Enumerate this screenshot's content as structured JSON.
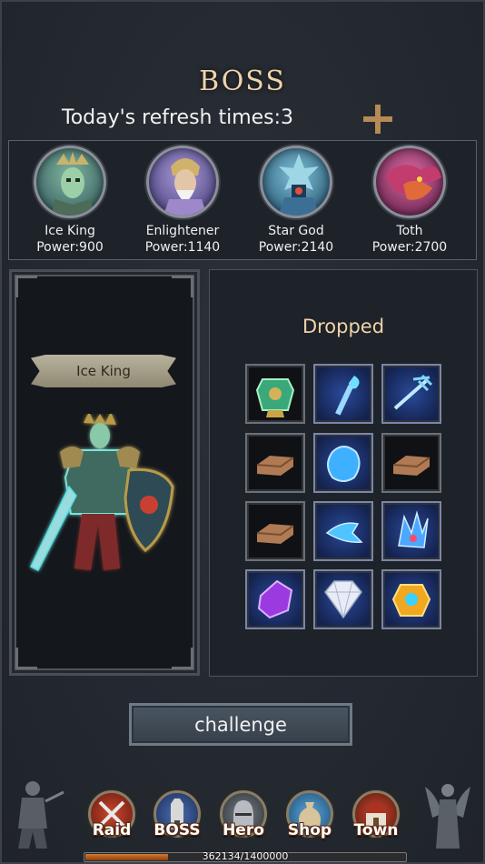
{
  "header": {
    "title": "BOSS",
    "refresh_label": "Today's  refresh times:3",
    "add_icon": "plus-icon",
    "accent_color": "#b58b55"
  },
  "bosses": [
    {
      "name": "Ice King",
      "power": "Power:900",
      "color": "#4f8a74"
    },
    {
      "name": "Enlightener",
      "power": "Power:1140",
      "color": "#7e6fb5"
    },
    {
      "name": "Star God",
      "power": "Power:2140",
      "color": "#3a7fa8"
    },
    {
      "name": "Toth",
      "power": "Power:2700",
      "color": "#b03a78"
    }
  ],
  "selected_boss": {
    "name": "Ice King"
  },
  "drops": {
    "title": "Dropped",
    "items": [
      {
        "icon": "jade-armor-icon",
        "style": "dark"
      },
      {
        "icon": "blue-staff-icon",
        "style": "blue"
      },
      {
        "icon": "blue-trident-icon",
        "style": "blue"
      },
      {
        "icon": "wood-plank-icon",
        "style": "dark"
      },
      {
        "icon": "blue-crystal-icon",
        "style": "blue"
      },
      {
        "icon": "wood-plank-icon",
        "style": "dark"
      },
      {
        "icon": "wood-plank-icon",
        "style": "dark"
      },
      {
        "icon": "blue-axe-icon",
        "style": "blue"
      },
      {
        "icon": "blue-claw-icon",
        "style": "blue"
      },
      {
        "icon": "purple-gem-icon",
        "style": "blue"
      },
      {
        "icon": "diamond-icon",
        "style": "blue"
      },
      {
        "icon": "gold-amulet-icon",
        "style": "blue"
      }
    ]
  },
  "challenge": {
    "label": "challenge"
  },
  "nav": [
    {
      "label": "Raid",
      "icon": "crossed-swords-icon",
      "color": "#a8321e"
    },
    {
      "label": "BOSS",
      "icon": "tower-icon",
      "color": "#2f4f8a"
    },
    {
      "label": "Hero",
      "icon": "helmet-icon",
      "color": "#555a60"
    },
    {
      "label": "Shop",
      "icon": "money-bag-icon",
      "color": "#3b7fb0"
    },
    {
      "label": "Town",
      "icon": "house-icon",
      "color": "#8a2a1e"
    }
  ],
  "progress": {
    "text": "362134/1400000",
    "fraction": 0.2587
  }
}
